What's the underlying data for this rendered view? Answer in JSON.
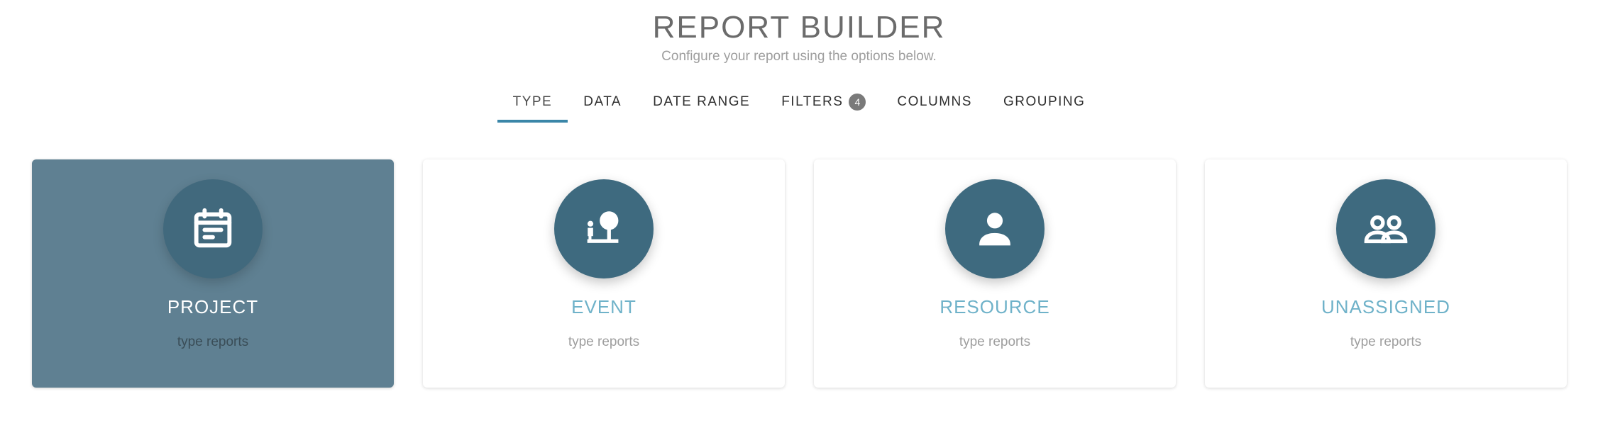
{
  "header": {
    "title": "REPORT BUILDER",
    "subtitle": "Configure your report using the options below."
  },
  "tabs": [
    {
      "label": "TYPE",
      "active": true
    },
    {
      "label": "DATA",
      "active": false
    },
    {
      "label": "DATE RANGE",
      "active": false
    },
    {
      "label": "FILTERS",
      "badge": "4",
      "active": false
    },
    {
      "label": "COLUMNS",
      "active": false
    },
    {
      "label": "GROUPING",
      "active": false
    }
  ],
  "cards": [
    {
      "title": "PROJECT",
      "subtitle": "type reports",
      "icon": "calendar-icon",
      "selected": true
    },
    {
      "title": "EVENT",
      "subtitle": "type reports",
      "icon": "event-icon",
      "selected": false
    },
    {
      "title": "RESOURCE",
      "subtitle": "type reports",
      "icon": "person-icon",
      "selected": false
    },
    {
      "title": "UNASSIGNED",
      "subtitle": "type reports",
      "icon": "group-icon",
      "selected": false
    }
  ],
  "colors": {
    "accent": "#3a86a8",
    "icon_circle": "#3e6a7f",
    "selected_card": "#5f8092",
    "card_title": "#6fb2c9"
  }
}
